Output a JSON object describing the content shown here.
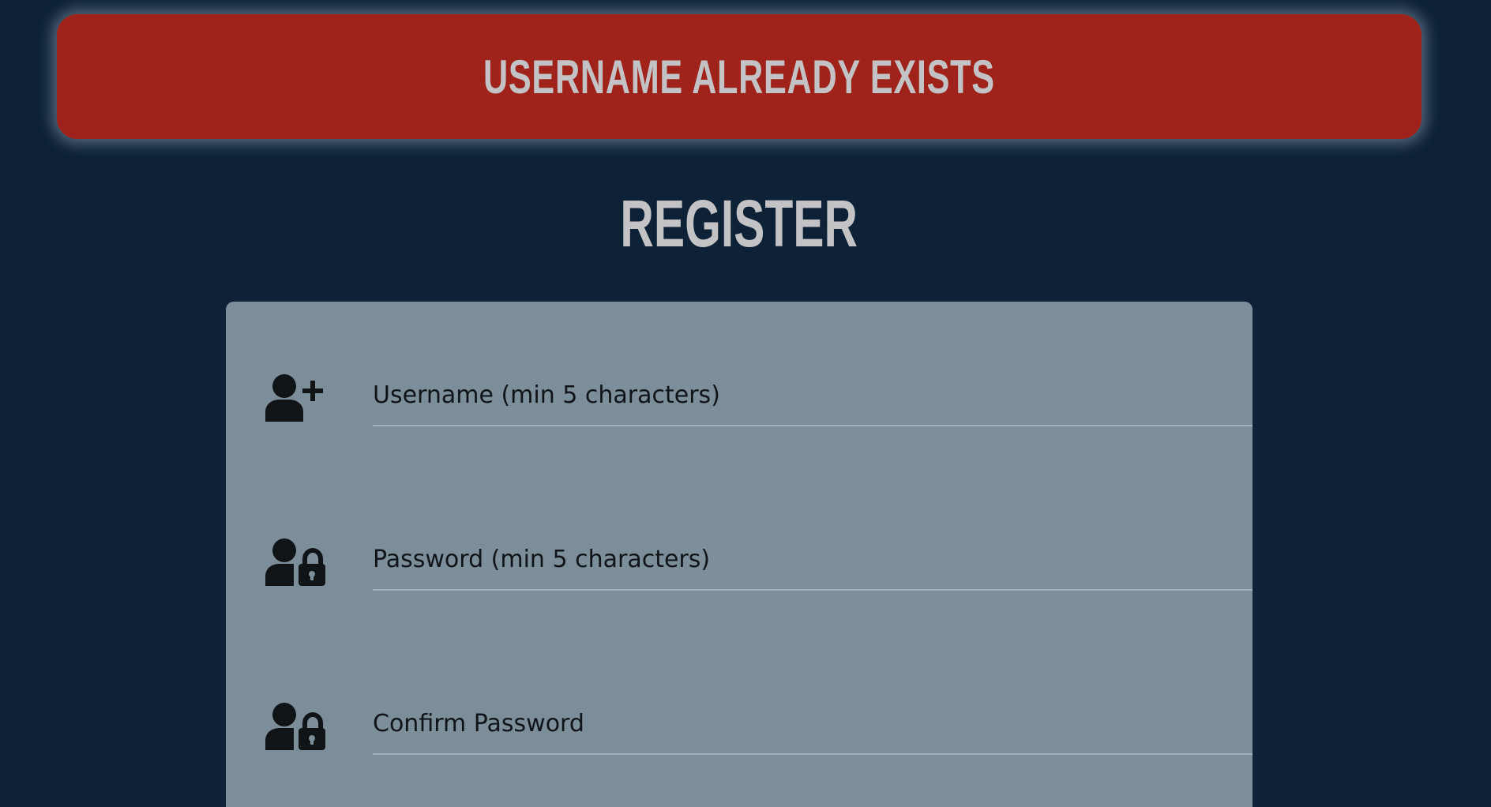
{
  "alert": {
    "message": "USERNAME ALREADY EXISTS",
    "color": "#a0231b"
  },
  "page": {
    "title": "REGISTER",
    "background": "#0d2237"
  },
  "form": {
    "fields": [
      {
        "icon": "user-plus-icon",
        "placeholder": "Username (min 5 characters)",
        "value": ""
      },
      {
        "icon": "user-lock-icon",
        "placeholder": "Password (min 5 characters)",
        "value": ""
      },
      {
        "icon": "user-lock-icon",
        "placeholder": "Confirm Password",
        "value": ""
      }
    ]
  }
}
